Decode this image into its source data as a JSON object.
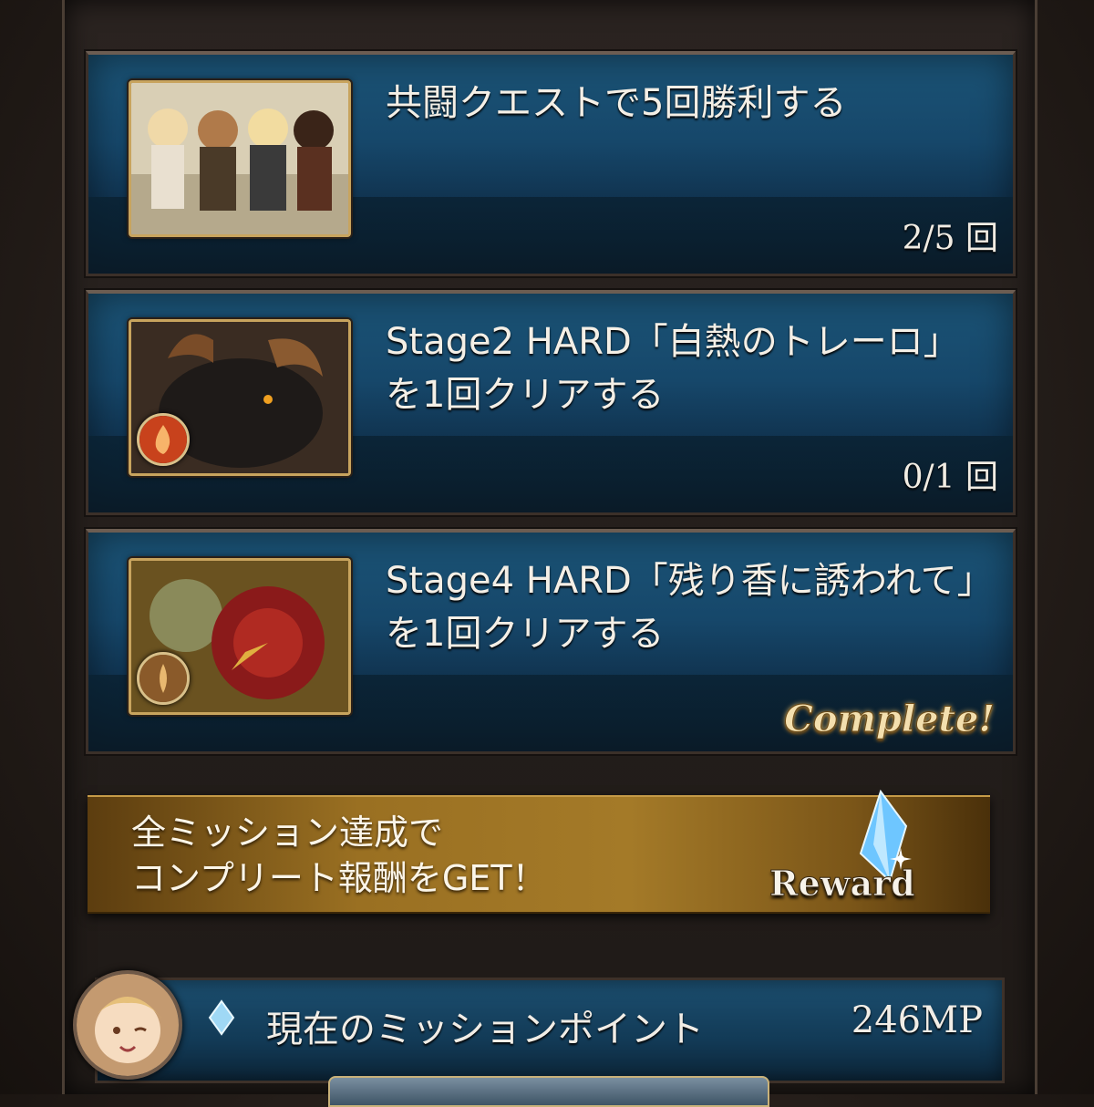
{
  "missions": [
    {
      "title": "共闘クエストで5回勝利する",
      "progress": "2/5 回",
      "thumb_icon": "characters-group-image"
    },
    {
      "title": "Stage2 HARD「白熱のトレーロ」を1回クリアする",
      "progress": "0/1 回",
      "thumb_icon": "minotaur-boss-image",
      "element_icon": "fire-element-icon"
    },
    {
      "title": "Stage4 HARD「残り香に誘われて」を1回クリアする",
      "status": "Complete!",
      "thumb_icon": "flower-monster-image",
      "element_icon": "earth-element-icon"
    }
  ],
  "reward_banner": {
    "line1": "全ミッション達成で",
    "line2": "コンプリート報酬をGET！",
    "label": "Reward",
    "icon": "crystal-icon"
  },
  "mission_points": {
    "label": "現在のミッションポイント",
    "value": "246MP",
    "icon": "diamond-icon"
  },
  "colors": {
    "panel_blue": "#16476a",
    "gold": "#a47a28",
    "frame_gold": "#c8a45e"
  }
}
